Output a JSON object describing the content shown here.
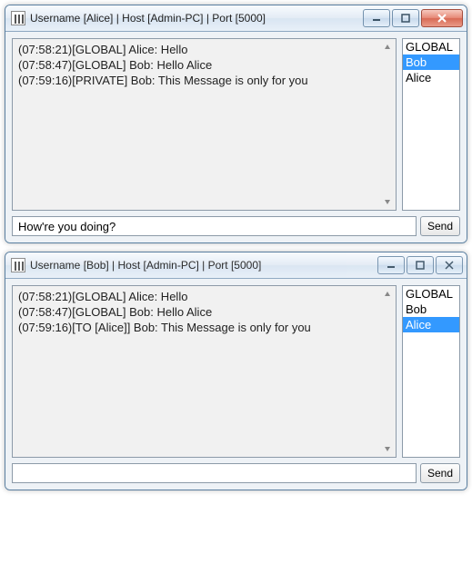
{
  "windows": [
    {
      "title": "Username [Alice] | Host [Admin-PC] | Port [5000]",
      "active": true,
      "messages": [
        "(07:58:21)[GLOBAL] Alice: Hello",
        "(07:58:47)[GLOBAL] Bob: Hello Alice",
        "(07:59:16)[PRIVATE] Bob: This Message is only for you"
      ],
      "users": [
        {
          "name": "GLOBAL",
          "selected": false
        },
        {
          "name": "Bob",
          "selected": true
        },
        {
          "name": "Alice",
          "selected": false
        }
      ],
      "input_value": "How're you doing?",
      "send_label": "Send"
    },
    {
      "title": "Username [Bob] | Host [Admin-PC] | Port [5000]",
      "active": false,
      "messages": [
        "(07:58:21)[GLOBAL] Alice: Hello",
        "(07:58:47)[GLOBAL] Bob: Hello Alice",
        "(07:59:16)[TO [Alice]] Bob: This Message is only for you"
      ],
      "users": [
        {
          "name": "GLOBAL",
          "selected": false
        },
        {
          "name": "Bob",
          "selected": false
        },
        {
          "name": "Alice",
          "selected": true
        }
      ],
      "input_value": "",
      "send_label": "Send"
    }
  ]
}
